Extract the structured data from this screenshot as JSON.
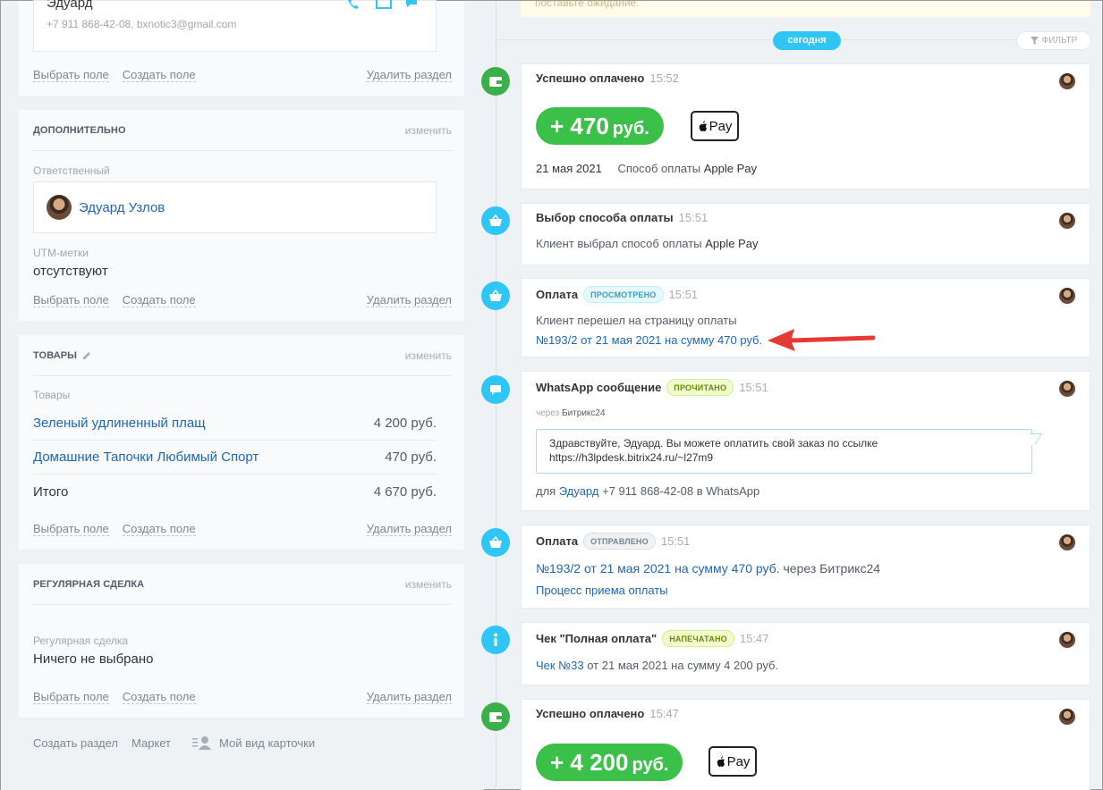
{
  "left": {
    "contact": {
      "name": "Эдуард",
      "info": "+7 911 868-42-08, bxnotic3@gmail.com"
    },
    "section1_links": {
      "choose": "Выбрать поле",
      "create": "Создать поле",
      "delete": "Удалить раздел"
    },
    "extra": {
      "title": "ДОПОЛНИТЕЛЬНО",
      "edit": "изменить",
      "responsible_label": "Ответственный",
      "responsible_name": "Эдуард Узлов",
      "utm_label": "UTM-метки",
      "utm_value": "отсутствуют",
      "links": {
        "choose": "Выбрать поле",
        "create": "Создать поле",
        "delete": "Удалить раздел"
      }
    },
    "goods": {
      "title": "ТОВАРЫ",
      "edit": "изменить",
      "label": "Товары",
      "items": [
        {
          "name": "Зеленый удлиненный плащ",
          "sum": "4 200 руб."
        },
        {
          "name": "Домашние Тапочки Любимый Спорт",
          "sum": "470 руб."
        }
      ],
      "total_label": "Итого",
      "total_sum": "4 670 руб.",
      "links": {
        "choose": "Выбрать поле",
        "create": "Создать поле",
        "delete": "Удалить раздел"
      }
    },
    "regular": {
      "title": "РЕГУЛЯРНАЯ СДЕЛКА",
      "edit": "изменить",
      "label": "Регулярная сделка",
      "value": "Ничего не выбрано",
      "links": {
        "choose": "Выбрать поле",
        "create": "Создать поле",
        "delete": "Удалить раздел"
      }
    },
    "bottom": {
      "create_section": "Создать раздел",
      "market": "Маркет",
      "my_view": "Мой вид карточки"
    }
  },
  "timeline": {
    "top_note": "поставьте ожидание.",
    "today": "сегодня",
    "filter": "ФИЛЬТР",
    "items": [
      {
        "title": "Успешно оплачено",
        "time": "15:52",
        "amount": "+ 470",
        "currency": "руб.",
        "date": "21 мая 2021",
        "method_label": "Способ оплаты",
        "method": "Apple Pay"
      },
      {
        "title": "Выбор способа оплаты",
        "time": "15:51",
        "text": "Клиент выбрал способ оплаты",
        "method": "Apple Pay"
      },
      {
        "title": "Оплата",
        "badge": "ПРОСМОТРЕНО",
        "time": "15:51",
        "text": "Клиент перешел на страницу оплаты",
        "link": "№193/2 от 21 мая 2021 на сумму 470 руб."
      },
      {
        "title": "WhatsApp сообщение",
        "badge": "ПРОЧИТАНО",
        "time": "15:51",
        "via_label": "через",
        "via": "Битрикс24",
        "message_line1": "Здравствуйте, Эдуард. Вы можете оплатить свой заказ по ссылке",
        "message_line2": "https://h3lpdesk.bitrix24.ru/~l27m9",
        "for_label": "для",
        "for_name": "Эдуард",
        "for_rest": "+7 911 868-42-08 в WhatsApp"
      },
      {
        "title": "Оплата",
        "badge": "ОТПРАВЛЕНО",
        "time": "15:51",
        "link": "№193/2 от 21 мая 2021 на сумму 470 руб.",
        "via": "через Битрикс24",
        "process": "Процесс приема оплаты"
      },
      {
        "title": "Чек \"Полная оплата\"",
        "badge": "НАПЕЧАТАНО",
        "time": "15:47",
        "link": "Чек №33",
        "rest": "от 21 мая 2021 на сумму 4 200 руб."
      },
      {
        "title": "Успешно оплачено",
        "time": "15:47",
        "amount": "+ 4 200",
        "currency": "руб."
      }
    ],
    "applepay_text": "Pay"
  },
  "colors": {
    "accent": "#2fc6f6",
    "success": "#3bc14a",
    "link": "#2067b0",
    "arrow": "#e53935"
  }
}
